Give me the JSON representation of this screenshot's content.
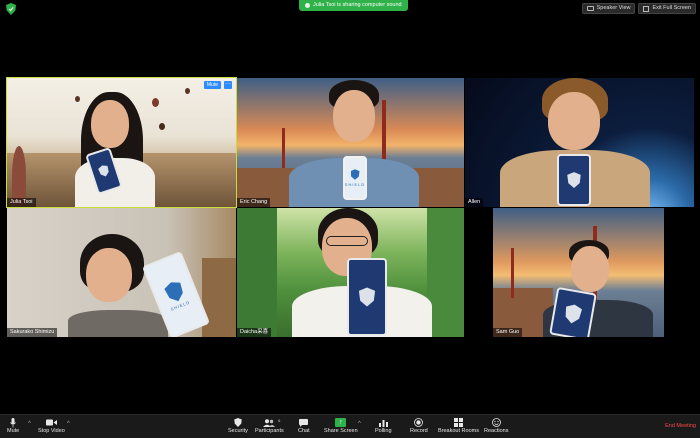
{
  "banner": {
    "text": "Julia Tsoi is sharing computer sound"
  },
  "topbar": {
    "speaker_view": "Speaker View",
    "exit_full_screen": "Exit Full Screen"
  },
  "tiles": [
    {
      "name": "Julia Tsoi",
      "mute": "Mute",
      "more": "···",
      "active": true
    },
    {
      "name": "Eric Chang"
    },
    {
      "name": "Allen"
    },
    {
      "name": "Sakurako Shimizu"
    },
    {
      "name": "Daicha采喜"
    },
    {
      "name": "Sam Guo"
    }
  ],
  "phone_label": "SHIELD",
  "toolbar": {
    "mute": "Mute",
    "stop_video": "Stop Video",
    "security": "Security",
    "participants": "Participants",
    "participants_count": "6",
    "chat": "Chat",
    "share_screen": "Share Screen",
    "polling": "Polling",
    "record": "Record",
    "breakout_rooms": "Breakout Rooms",
    "reactions": "Reactions",
    "end_meeting": "End Meeting"
  },
  "colors": {
    "active_speaker": "#c8dc3c",
    "share_green": "#2fb24a",
    "zoom_blue": "#2d8cff",
    "end_red": "#ff4a4a"
  }
}
